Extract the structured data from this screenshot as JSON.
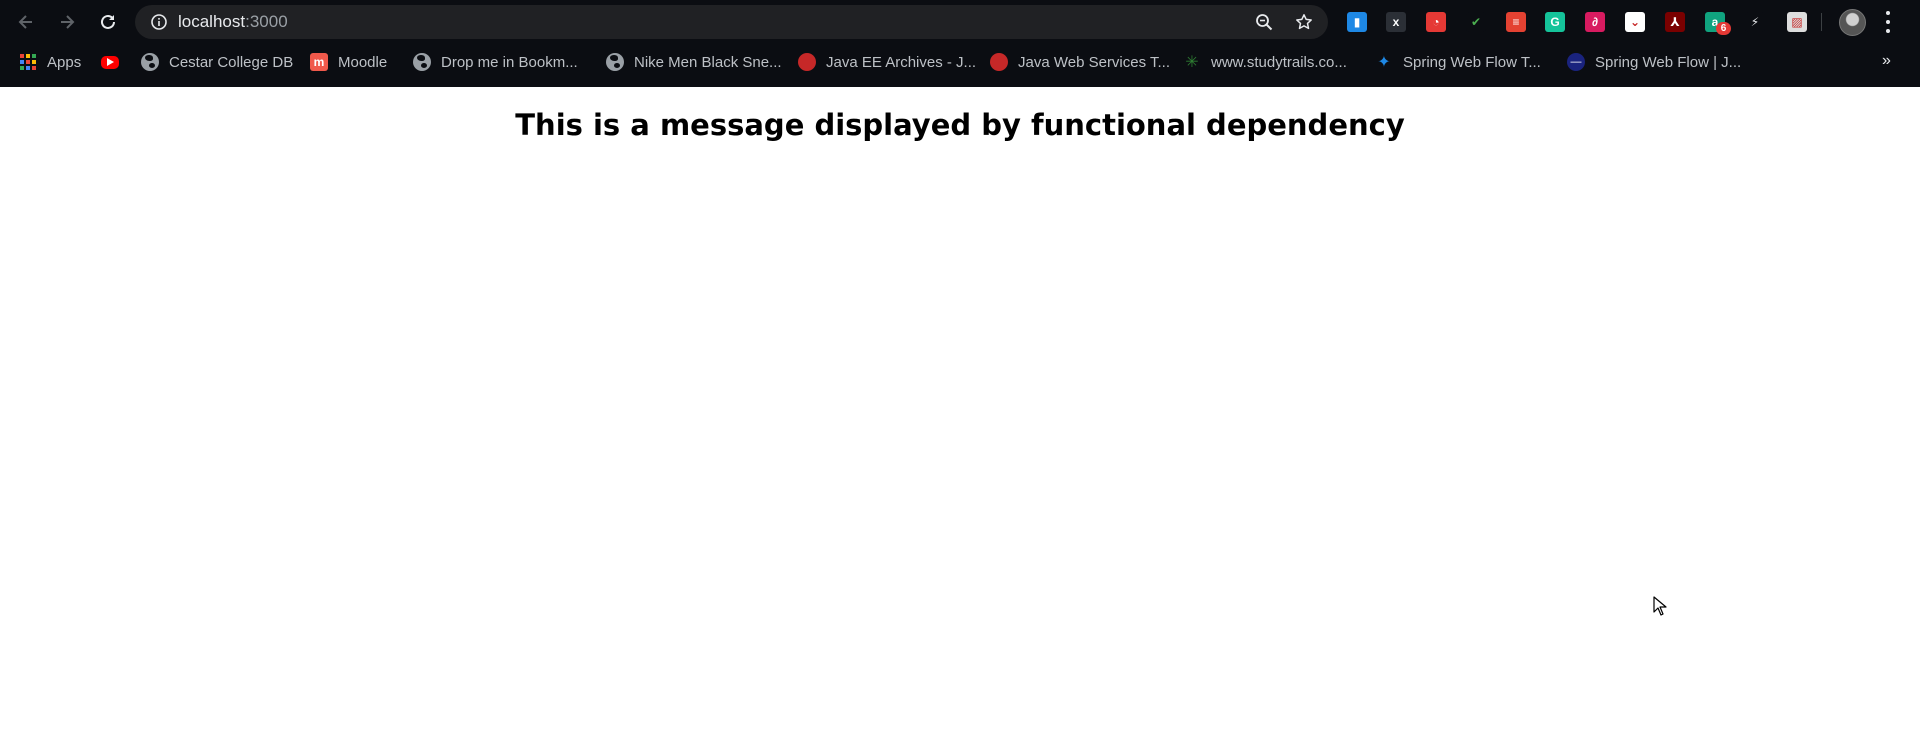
{
  "browser": {
    "address_bar": {
      "host": "localhost",
      "port": ":3000"
    },
    "extensions": [
      {
        "name": "trello-extension",
        "color": "#1e88e5",
        "glyph": "▮"
      },
      {
        "name": "x-extension",
        "color": "#2b2f36",
        "glyph": "x"
      },
      {
        "name": "timer-extension",
        "color": "#e53935",
        "glyph": "◔"
      },
      {
        "name": "check-extension",
        "color": "#0b0d12",
        "glyph": "✔"
      },
      {
        "name": "todoist-extension",
        "color": "#e44232",
        "glyph": "≡"
      },
      {
        "name": "grammarly-extension",
        "color": "#15c39a",
        "glyph": "G"
      },
      {
        "name": "pdf-sign-extension",
        "color": "#d81b60",
        "glyph": "∂"
      },
      {
        "name": "pocket-extension",
        "color": "#ffffff",
        "glyph": "⌄"
      },
      {
        "name": "adobe-pdf-extension",
        "color": "#7a0000",
        "glyph": "⅄"
      },
      {
        "name": "badge-extension",
        "color": "#10a37f",
        "glyph": "a",
        "badge": "6"
      },
      {
        "name": "pulse-extension",
        "color": "#0b0d12",
        "glyph": "⚡"
      },
      {
        "name": "image-extension",
        "color": "#dddddd",
        "glyph": "▨"
      }
    ]
  },
  "bookmarks": [
    {
      "label": "Apps",
      "icon": "apps-grid-icon"
    },
    {
      "label": "",
      "icon": "youtube-icon"
    },
    {
      "label": "Cestar College DB",
      "icon": "globe-icon"
    },
    {
      "label": "Moodle",
      "icon": "moodle-icon"
    },
    {
      "label": "Drop me in Bookm...",
      "icon": "globe-icon"
    },
    {
      "label": "Nike Men Black Sne...",
      "icon": "globe-icon"
    },
    {
      "label": "Java EE Archives - J...",
      "icon": "java-icon"
    },
    {
      "label": "Java Web Services T...",
      "icon": "java-icon"
    },
    {
      "label": "www.studytrails.co...",
      "icon": "studytrails-icon"
    },
    {
      "label": "Spring Web Flow T...",
      "icon": "spring-icon"
    },
    {
      "label": "Spring Web Flow | J...",
      "icon": "spring-icon-2"
    }
  ],
  "page": {
    "title": "This is a message displayed by functional dependency"
  }
}
